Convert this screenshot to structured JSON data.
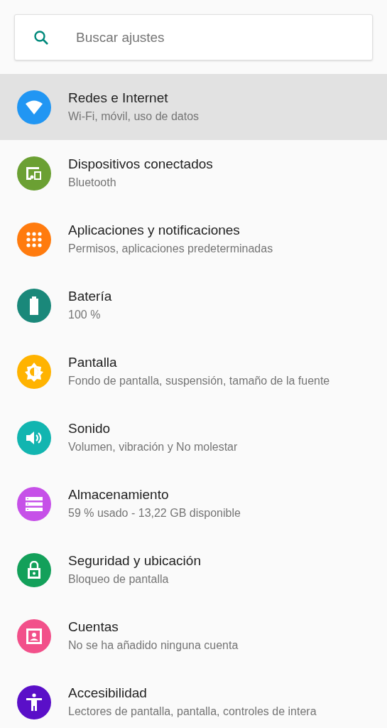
{
  "search": {
    "placeholder": "Buscar ajustes"
  },
  "items": [
    {
      "kind": "wifi",
      "title": "Redes e Internet",
      "subtitle": "Wi-Fi, móvil, uso de datos",
      "color": "#2196f3",
      "selected": true
    },
    {
      "kind": "devices",
      "title": "Dispositivos conectados",
      "subtitle": "Bluetooth",
      "color": "#6ba033",
      "selected": false
    },
    {
      "kind": "apps",
      "title": "Aplicaciones y notificaciones",
      "subtitle": "Permisos, aplicaciones predeterminadas",
      "color": "#ff7b0e",
      "selected": false
    },
    {
      "kind": "battery",
      "title": "Batería",
      "subtitle": "100 %",
      "color": "#1a887a",
      "selected": false
    },
    {
      "kind": "display",
      "title": "Pantalla",
      "subtitle": "Fondo de pantalla, suspensión, tamaño de la fuente",
      "color": "#ffb300",
      "selected": false
    },
    {
      "kind": "sound",
      "title": "Sonido",
      "subtitle": "Volumen, vibración y No molestar",
      "color": "#12b5b0",
      "selected": false
    },
    {
      "kind": "storage",
      "title": "Almacenamiento",
      "subtitle": "59 % usado - 13,22 GB disponible",
      "color": "#c650e8",
      "selected": false
    },
    {
      "kind": "security",
      "title": "Seguridad y ubicación",
      "subtitle": "Bloqueo de pantalla",
      "color": "#13a05a",
      "selected": false
    },
    {
      "kind": "accounts",
      "title": "Cuentas",
      "subtitle": "No se ha añadido ninguna cuenta",
      "color": "#f2508a",
      "selected": false
    },
    {
      "kind": "accessibility",
      "title": "Accesibilidad",
      "subtitle": "Lectores de pantalla, pantalla, controles de intera",
      "color": "#5a0fc8",
      "selected": false
    }
  ]
}
